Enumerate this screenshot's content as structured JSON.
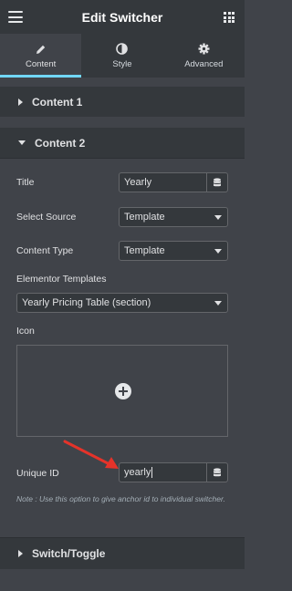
{
  "header": {
    "title": "Edit Switcher",
    "menu_icon": "hamburger-icon",
    "apps_icon": "apps-grid-icon"
  },
  "tabs": [
    {
      "label": "Content",
      "icon": "pencil-icon",
      "active": true
    },
    {
      "label": "Style",
      "icon": "half-circle-icon",
      "active": false
    },
    {
      "label": "Advanced",
      "icon": "gear-icon",
      "active": false
    }
  ],
  "sections": {
    "content1": {
      "label": "Content 1",
      "expanded": false
    },
    "content2": {
      "label": "Content 2",
      "expanded": true
    },
    "switch_toggle": {
      "label": "Switch/Toggle",
      "expanded": false
    }
  },
  "fields": {
    "title": {
      "label": "Title",
      "value": "Yearly"
    },
    "select_source": {
      "label": "Select Source",
      "value": "Template"
    },
    "content_type": {
      "label": "Content Type",
      "value": "Template"
    },
    "elementor_templates": {
      "label": "Elementor Templates",
      "value": "Yearly Pricing Table (section)"
    },
    "icon": {
      "label": "Icon"
    },
    "unique_id": {
      "label": "Unique ID",
      "value": "yearly"
    }
  },
  "note": "Note : Use this option to give anchor id to individual switcher.",
  "colors": {
    "panel_bg": "#404349",
    "header_bg": "#34383c",
    "active_tab_indicator": "#71d7f7",
    "annotation_arrow": "#e5332a"
  }
}
